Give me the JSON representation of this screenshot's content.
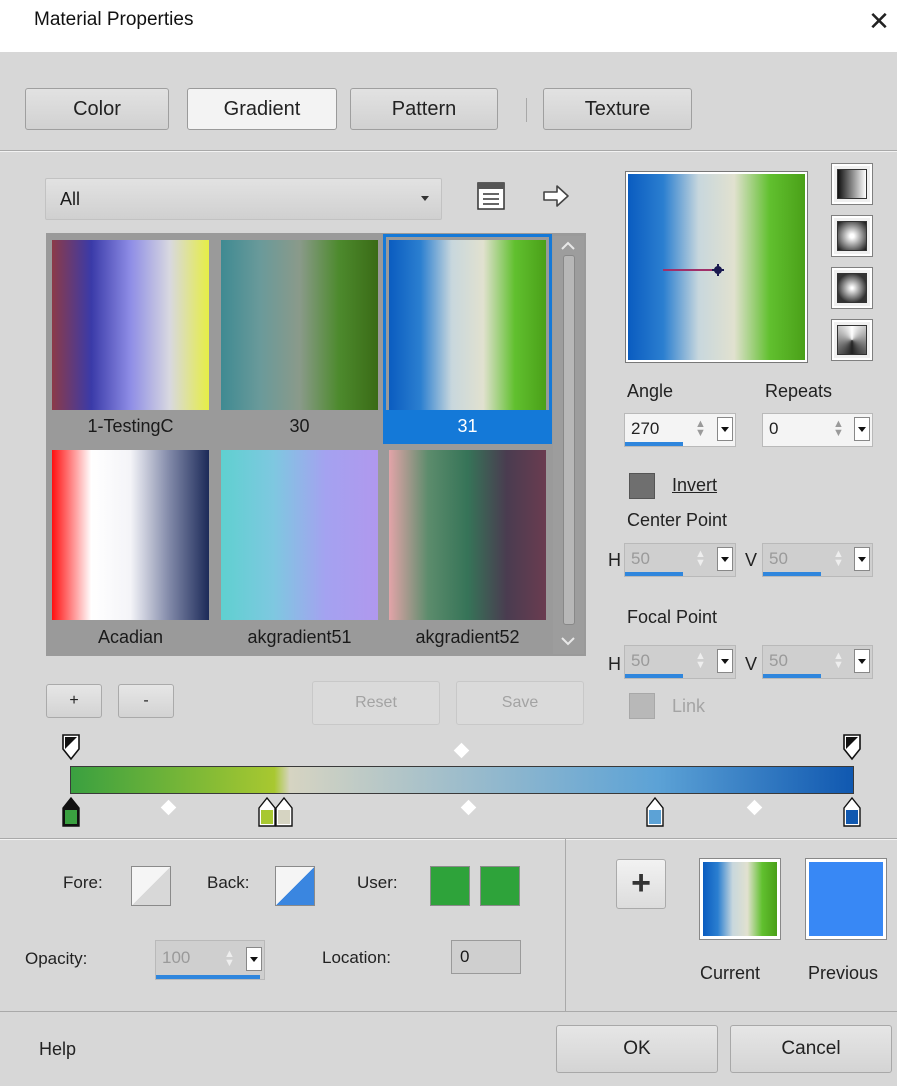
{
  "window": {
    "title": "Material Properties",
    "close_glyph": "✕"
  },
  "tabs": [
    {
      "label": "Color",
      "active": false
    },
    {
      "label": "Gradient",
      "active": true
    },
    {
      "label": "Pattern",
      "active": false
    },
    {
      "label": "Texture",
      "active": false
    }
  ],
  "library": {
    "category": "All",
    "gradients": [
      {
        "name": "1-TestingC",
        "stops": [
          "#8c3a48",
          "#3a3aa8",
          "#8e8de6",
          "#d8d8e0",
          "#e6ee45"
        ],
        "selected": false
      },
      {
        "name": "30",
        "stops": [
          "#3f8a92",
          "#6a9a9a",
          "#8a9a8a",
          "#4d8a2d",
          "#3a6b16"
        ],
        "selected": false
      },
      {
        "name": "31",
        "stops": [
          "#0a5cc0",
          "#2b7fd0",
          "#c8d7dd",
          "#e1e1cf",
          "#61c02f",
          "#4aa018"
        ],
        "selected": true
      },
      {
        "name": "Acadian",
        "stops": [
          "#ff1010",
          "#ffffff",
          "#f4f4f8",
          "#8088a8",
          "#1c2a58"
        ],
        "selected": false
      },
      {
        "name": "akgradient51",
        "stops": [
          "#5fd0d0",
          "#7ec8e0",
          "#a4a2f0",
          "#b098ee"
        ],
        "selected": false
      },
      {
        "name": "akgradient52",
        "stops": [
          "#e2a4a8",
          "#5c8c6c",
          "#367458",
          "#4a3c50",
          "#6a3c50"
        ],
        "selected": false
      }
    ],
    "add_label": "+",
    "remove_label": "-",
    "reset_label": "Reset",
    "save_label": "Save"
  },
  "settings": {
    "angle_label": "Angle",
    "angle_value": "270",
    "repeats_label": "Repeats",
    "repeats_value": "0",
    "invert_label": "Invert",
    "center_point_label": "Center Point",
    "center_h": "50",
    "center_v": "50",
    "focal_point_label": "Focal Point",
    "focal_h": "50",
    "focal_v": "50",
    "h_label": "H",
    "v_label": "V",
    "link_label": "Link"
  },
  "gradient_editor": {
    "stops": [
      {
        "position": 0,
        "color": "#3aa040"
      },
      {
        "position": 0.26,
        "color": "#a8c830"
      },
      {
        "position": 0.28,
        "color": "#d6d4c2"
      },
      {
        "position": 0.75,
        "color": "#5ca2d6"
      },
      {
        "position": 1,
        "color": "#1058b0"
      }
    ]
  },
  "bottom": {
    "fore_label": "Fore:",
    "back_label": "Back:",
    "user_label": "User:",
    "opacity_label": "Opacity:",
    "opacity_value": "100",
    "location_label": "Location:",
    "location_value": "0",
    "add_glyph": "+",
    "current_label": "Current",
    "previous_label": "Previous",
    "user_color_1": "#2ea33a",
    "user_color_2": "#2ea33a",
    "previous_color": "#3888f5"
  },
  "footer": {
    "help_label": "Help",
    "ok_label": "OK",
    "cancel_label": "Cancel"
  },
  "colors": {
    "selection": "#1479d8",
    "dialog_bg": "#d7d7d7",
    "accent_bar": "#2f86dd"
  }
}
